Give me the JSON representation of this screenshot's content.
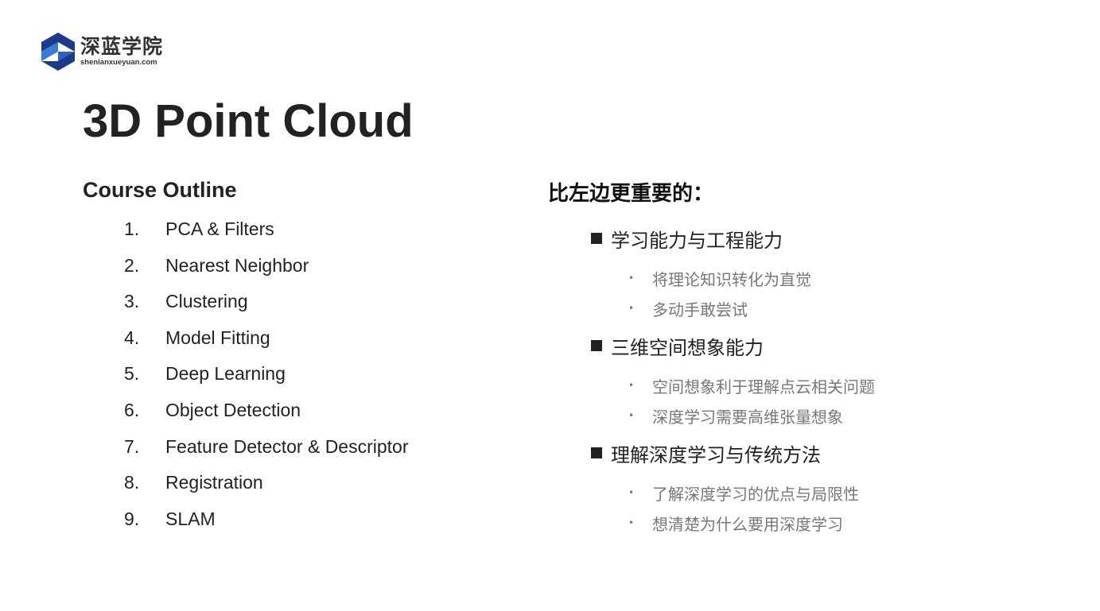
{
  "logo": {
    "name_cn": "深蓝学院",
    "url": "shenlanxueyuan.com",
    "colors": {
      "dark": "#1b3a8c",
      "light": "#3a7bd5"
    }
  },
  "title": "3D Point Cloud",
  "outline": {
    "heading": "Course Outline",
    "items": [
      {
        "num": "1.",
        "text": "PCA & Filters"
      },
      {
        "num": "2.",
        "text": "Nearest Neighbor"
      },
      {
        "num": "3.",
        "text": "Clustering"
      },
      {
        "num": "4.",
        "text": "Model Fitting"
      },
      {
        "num": "5.",
        "text": "Deep Learning"
      },
      {
        "num": "6.",
        "text": "Object Detection"
      },
      {
        "num": "7.",
        "text": "Feature Detector & Descriptor"
      },
      {
        "num": "8.",
        "text": "Registration"
      },
      {
        "num": "9.",
        "text": "SLAM"
      }
    ]
  },
  "right": {
    "heading": "比左边更重要的：",
    "sections": [
      {
        "title": "学习能力与工程能力",
        "items": [
          "将理论知识转化为直觉",
          "多动手敢尝试"
        ]
      },
      {
        "title": "三维空间想象能力",
        "items": [
          "空间想象利于理解点云相关问题",
          "深度学习需要高维张量想象"
        ]
      },
      {
        "title": "理解深度学习与传统方法",
        "items": [
          "了解深度学习的优点与局限性",
          "想清楚为什么要用深度学习"
        ]
      }
    ]
  }
}
